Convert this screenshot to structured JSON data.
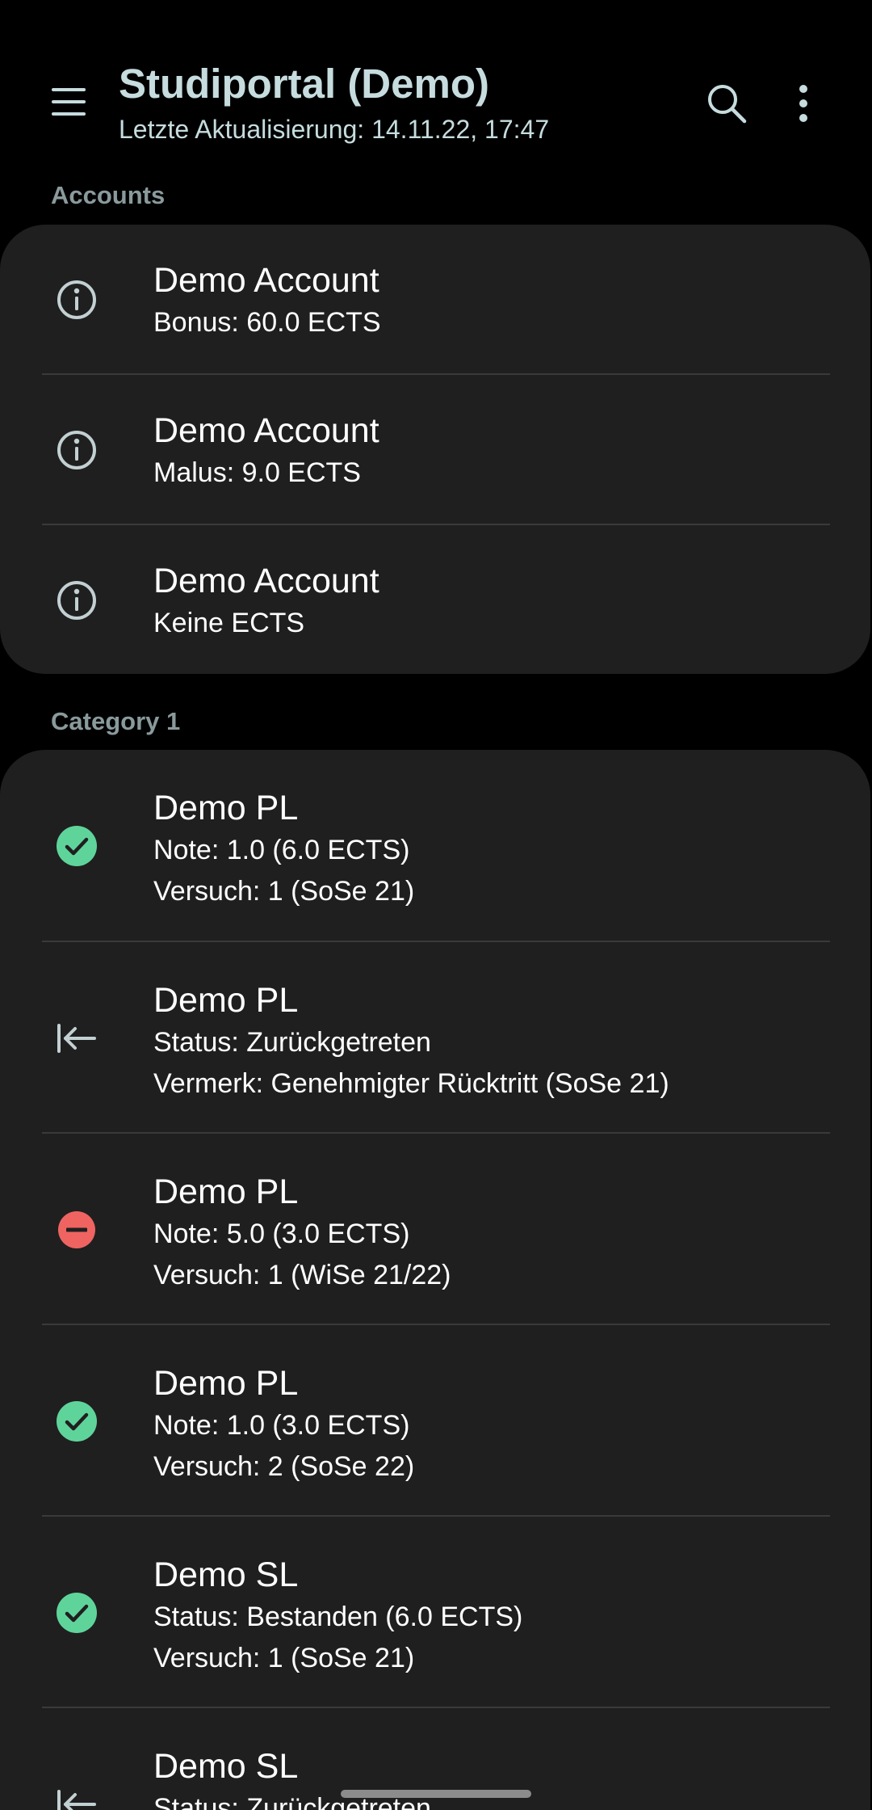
{
  "header": {
    "title": "Studiportal (Demo)",
    "subtitle": "Letzte Aktualisierung: 14.11.22, 17:47",
    "menu_icon": "hamburger-menu-icon",
    "search_icon": "search-icon",
    "more_icon": "more-vert-icon"
  },
  "sections": {
    "accounts": {
      "label": "Accounts",
      "items": [
        {
          "title": "Demo Account",
          "line1": "Bonus: 60.0 ECTS",
          "icon": "info-icon"
        },
        {
          "title": "Demo Account",
          "line1": "Malus: 9.0 ECTS",
          "icon": "info-icon"
        },
        {
          "title": "Demo Account",
          "line1": "Keine ECTS",
          "icon": "info-icon"
        }
      ]
    },
    "category1": {
      "label": "Category 1",
      "items": [
        {
          "title": "Demo PL",
          "line1": "Note: 1.0 (6.0 ECTS)",
          "line2": "Versuch: 1 (SoSe 21)",
          "icon": "check-circle-icon"
        },
        {
          "title": "Demo PL",
          "line1": "Status: Zurückgetreten",
          "line2": "Vermerk: Genehmigter Rücktritt (SoSe 21)",
          "icon": "withdrawn-arrow-icon"
        },
        {
          "title": "Demo PL",
          "line1": "Note: 5.0 (3.0 ECTS)",
          "line2": "Versuch: 1 (WiSe 21/22)",
          "icon": "failed-minus-circle-icon"
        },
        {
          "title": "Demo PL",
          "line1": "Note: 1.0 (3.0 ECTS)",
          "line2": "Versuch: 2 (SoSe 22)",
          "icon": "check-circle-icon"
        },
        {
          "title": "Demo SL",
          "line1": "Status: Bestanden (6.0 ECTS)",
          "line2": "Versuch: 1 (SoSe 21)",
          "icon": "check-circle-icon"
        },
        {
          "title": "Demo SL",
          "line1": "Status: Zurückgetreten",
          "icon": "withdrawn-arrow-icon"
        }
      ]
    }
  },
  "colors": {
    "background": "#000000",
    "card": "#1f1f20",
    "title_accent": "#c6dcde",
    "section_label": "#8a9a9c",
    "passed_green": "#5fd49a",
    "failed_red": "#ef6461",
    "icon_gray": "#c3d0d2"
  }
}
